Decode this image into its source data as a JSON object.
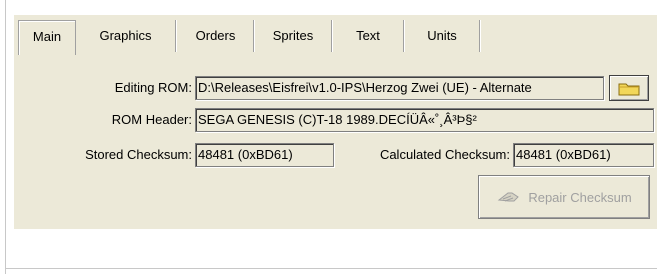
{
  "tabs": [
    {
      "label": "Main"
    },
    {
      "label": "Graphics"
    },
    {
      "label": "Orders"
    },
    {
      "label": "Sprites"
    },
    {
      "label": "Text"
    },
    {
      "label": "Units"
    }
  ],
  "active_tab": "Main",
  "rom": {
    "editing_label": "Editing ROM:",
    "editing_value": "D:\\Releases\\Eisfrei\\v1.0-IPS\\Herzog Zwei (UE) - Alternate",
    "header_label": "ROM Header:",
    "header_value": "SEGA GENESIS    (C)T-18 1989.DECÍÜÂ«˚¸Â³Þ§²"
  },
  "checksum": {
    "stored_label": "Stored Checksum:",
    "stored_value": "48481 (0xBD61)",
    "calculated_label": "Calculated Checksum:",
    "calculated_value": "48481 (0xBD61)",
    "repair_label": "Repair Checksum",
    "repair_icon": "wrench-icon"
  },
  "icons": {
    "browse": "folder-icon"
  },
  "colors": {
    "panel_bg": "#ece9d8",
    "disabled_text": "#a0a0a0",
    "folder_yellow": "#f2d75a"
  }
}
